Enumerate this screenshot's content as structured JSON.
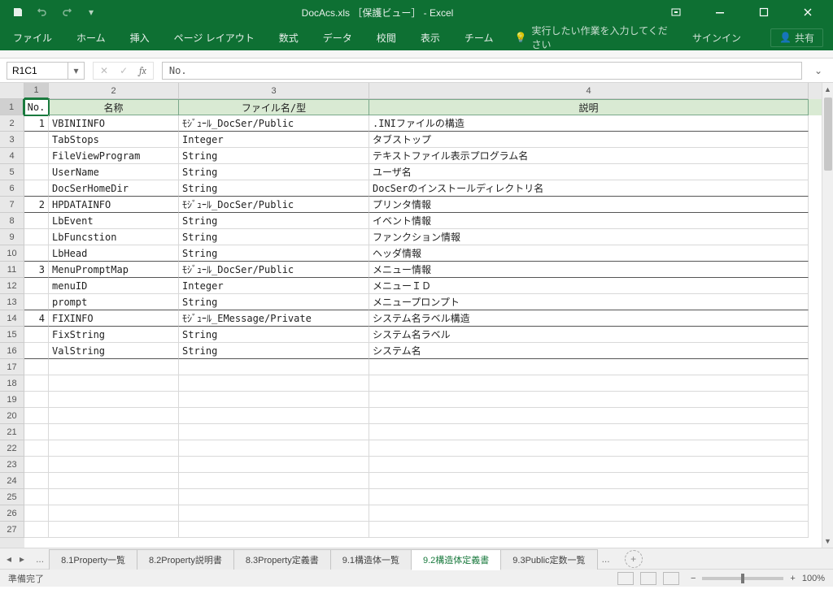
{
  "titlebar": {
    "title": "DocAcs.xls ［保護ビュー］ - Excel"
  },
  "ribbon": {
    "tabs": [
      "ファイル",
      "ホーム",
      "挿入",
      "ページ レイアウト",
      "数式",
      "データ",
      "校閲",
      "表示",
      "チーム"
    ],
    "tell": "実行したい作業を入力してください",
    "signin": "サインイン",
    "share": "共有"
  },
  "fbar": {
    "name": "R1C1",
    "formula": "No."
  },
  "columns": {
    "headers": [
      "1",
      "2",
      "3",
      "4"
    ],
    "widths": [
      30,
      160,
      234,
      540
    ]
  },
  "sheet": {
    "header": [
      "No.",
      "名称",
      "ファイル名/型",
      "説明"
    ],
    "rows": [
      {
        "no": "1",
        "name": "VBINIINFO",
        "type": "ﾓｼﾞｭｰﾙ_DocSer/Public",
        "desc": ".INIファイルの構造",
        "bold": true
      },
      {
        "no": "",
        "name": "TabStops",
        "type": "Integer",
        "desc": "タブストップ"
      },
      {
        "no": "",
        "name": "FileViewProgram",
        "type": "String",
        "desc": "テキストファイル表示プログラム名"
      },
      {
        "no": "",
        "name": "UserName",
        "type": "String",
        "desc": "ユーザ名"
      },
      {
        "no": "",
        "name": "DocSerHomeDir",
        "type": "String",
        "desc": "DocSerのインストールディレクトリ名",
        "bold": true
      },
      {
        "no": "2",
        "name": "HPDATAINFO",
        "type": "ﾓｼﾞｭｰﾙ_DocSer/Public",
        "desc": "プリンタ情報",
        "bold": true
      },
      {
        "no": "",
        "name": "LbEvent",
        "type": "String",
        "desc": "イベント情報"
      },
      {
        "no": "",
        "name": "LbFuncstion",
        "type": "String",
        "desc": "ファンクション情報"
      },
      {
        "no": "",
        "name": "LbHead",
        "type": "String",
        "desc": "ヘッダ情報",
        "bold": true
      },
      {
        "no": "3",
        "name": "MenuPromptMap",
        "type": "ﾓｼﾞｭｰﾙ_DocSer/Public",
        "desc": "メニュー情報",
        "bold": true
      },
      {
        "no": "",
        "name": "menuID",
        "type": "Integer",
        "desc": "メニューＩＤ"
      },
      {
        "no": "",
        "name": "prompt",
        "type": "String",
        "desc": "メニュープロンプト",
        "bold": true
      },
      {
        "no": "4",
        "name": "FIXINFO",
        "type": "ﾓｼﾞｭｰﾙ_EMessage/Private",
        "desc": "システム名ラベル構造",
        "bold": true
      },
      {
        "no": "",
        "name": "FixString",
        "type": "String",
        "desc": "システム名ラベル"
      },
      {
        "no": "",
        "name": "ValString",
        "type": "String",
        "desc": "システム名",
        "bold": true
      }
    ],
    "empty_rows": 11,
    "row_labels": [
      "1",
      "2",
      "3",
      "4",
      "5",
      "6",
      "7",
      "8",
      "9",
      "10",
      "11",
      "12",
      "13",
      "14",
      "15",
      "16",
      "17",
      "18",
      "19",
      "20",
      "21",
      "22",
      "23",
      "24",
      "25",
      "26",
      "27"
    ]
  },
  "tabs": {
    "items": [
      "8.1Property一覧",
      "8.2Property説明書",
      "8.3Property定義書",
      "9.1構造体一覧",
      "9.2構造体定義書",
      "9.3Public定数一覧"
    ],
    "active": 4
  },
  "status": {
    "ready": "準備完了",
    "zoom": "100%"
  }
}
